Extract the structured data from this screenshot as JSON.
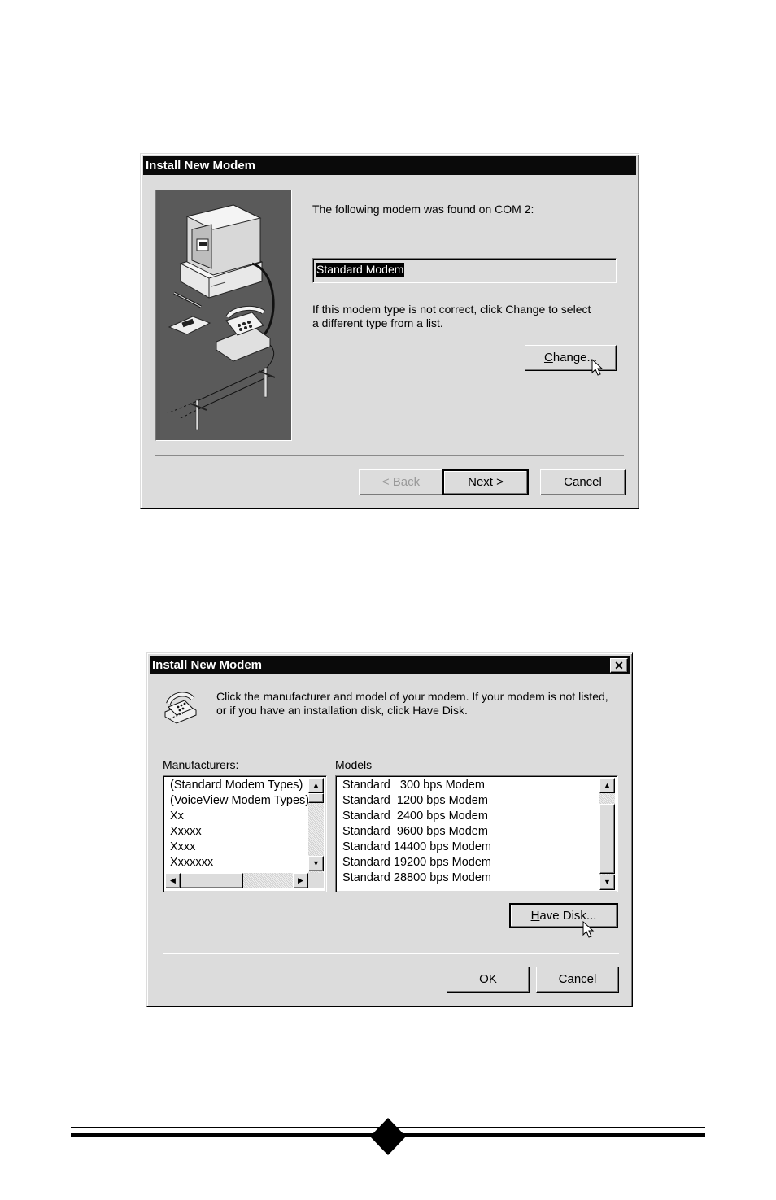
{
  "dialog1": {
    "title": "Install New Modem",
    "found_text": "The following modem was found on COM 2:",
    "modem_value": "Standard Modem",
    "hint_text_line1": "If this modem type is not correct, click Change to select",
    "hint_text_line2": "a different type from a list.",
    "change_button": {
      "prefix": "",
      "mnemonic": "C",
      "rest": "hange..."
    },
    "back_button": {
      "prefix": "< ",
      "mnemonic": "B",
      "rest": "ack",
      "disabled": true
    },
    "next_button": {
      "prefix": "",
      "mnemonic": "N",
      "rest": "ext >"
    },
    "cancel_button": "Cancel",
    "illustration": "computer-phone-modem-illustration"
  },
  "dialog2": {
    "title": "Install New Modem",
    "close_glyph": "✕",
    "instruction_line1": "Click the manufacturer and model of your modem. If your modem is not listed,",
    "instruction_line2": "or if you have an installation disk, click Have Disk.",
    "manufacturers_label": {
      "mnemonic": "M",
      "rest": "anufacturers:"
    },
    "models_label": {
      "prefix": "Mode",
      "mnemonic": "l",
      "rest": "s"
    },
    "manufacturers": [
      "(Standard Modem Types)",
      "(VoiceView Modem Types)",
      "Xx",
      "Xxxxx",
      "Xxxx",
      "Xxxxxxx"
    ],
    "models": [
      "Standard   300 bps Modem",
      "Standard  1200 bps Modem",
      "Standard  2400 bps Modem",
      "Standard  9600 bps Modem",
      "Standard 14400 bps Modem",
      "Standard 19200 bps Modem",
      "Standard 28800 bps Modem"
    ],
    "have_disk_button": {
      "mnemonic": "H",
      "rest": "ave Disk..."
    },
    "ok_button": "OK",
    "cancel_button": "Cancel"
  },
  "footer": {
    "ornament": "diamond-rule"
  }
}
